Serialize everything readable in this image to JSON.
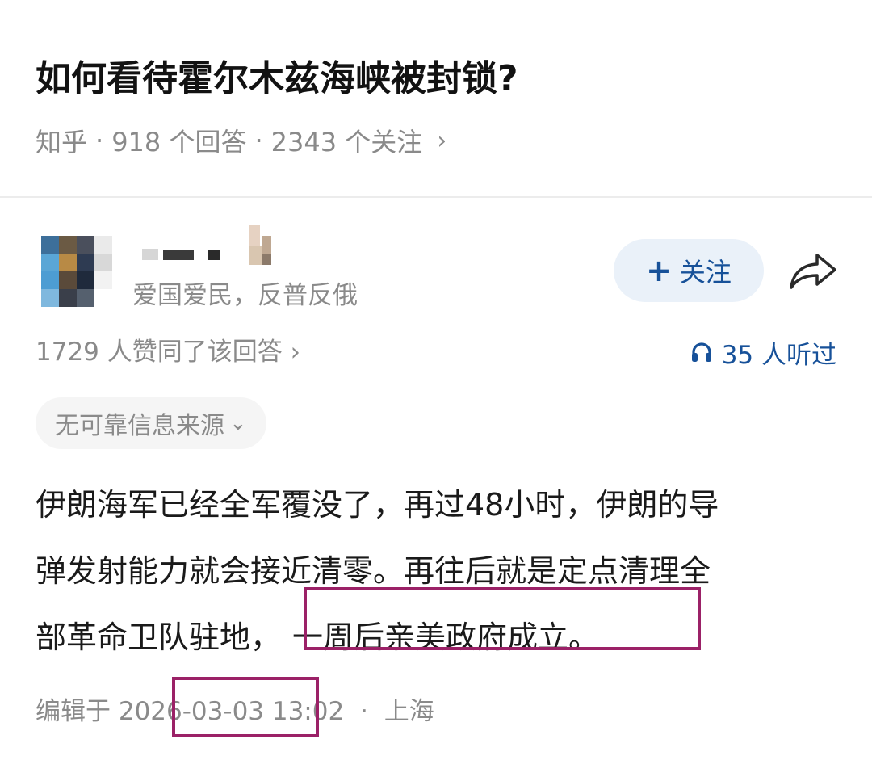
{
  "question": {
    "title": "如何看待霍尔木兹海峡被封锁?",
    "source": "知乎",
    "answers": "918 个回答",
    "followers": "2343 个关注",
    "separator": "·",
    "chevron": "›"
  },
  "author": {
    "bio": "爱国爱民，反普反俄",
    "follow_label": "关注",
    "follow_icon": "plus-icon",
    "share_icon": "share-arrow-icon"
  },
  "stats": {
    "upvotes": "1729 人赞同了该回答 ›",
    "listeners": "35 人听过",
    "listeners_icon": "headphones-icon"
  },
  "tag": {
    "label": "无可靠信息来源",
    "chevron": "⌄"
  },
  "answer": {
    "lines": [
      "伊朗海军已经全军覆没了，再过48小时，伊朗的导",
      "弹发射能力就会接近清零。再往后就是定点清理全",
      "部革命卫队驻地，"
    ],
    "highlight": "一周后亲美政府成立。"
  },
  "footer": {
    "edited": "编辑于 2026-03-03 13:02",
    "separator": "·",
    "location": "上海"
  },
  "colors": {
    "accent": "#175199",
    "follow_bg": "#eaf1f9",
    "muted": "#8a8a8a",
    "annotation": "#9b2167"
  }
}
